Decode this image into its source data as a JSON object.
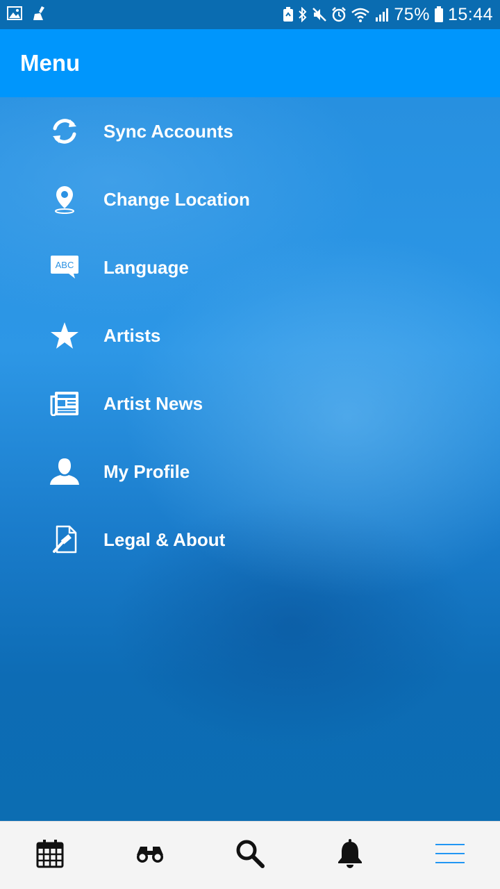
{
  "status_bar": {
    "battery": "75%",
    "time": "15:44"
  },
  "header": {
    "title": "Menu"
  },
  "menu": {
    "items": [
      {
        "label": "Sync Accounts",
        "icon": "sync-icon"
      },
      {
        "label": "Change Location",
        "icon": "location-pin-icon"
      },
      {
        "label": "Language",
        "icon": "language-abc-icon"
      },
      {
        "label": "Artists",
        "icon": "star-icon"
      },
      {
        "label": "Artist News",
        "icon": "newspaper-icon"
      },
      {
        "label": "My Profile",
        "icon": "profile-icon"
      },
      {
        "label": "Legal & About",
        "icon": "legal-document-icon"
      }
    ]
  },
  "bottom_nav": {
    "items": [
      {
        "icon": "calendar-icon"
      },
      {
        "icon": "binoculars-icon"
      },
      {
        "icon": "search-icon"
      },
      {
        "icon": "bell-icon"
      },
      {
        "icon": "hamburger-menu-icon",
        "active": true
      }
    ]
  },
  "colors": {
    "header": "#0096fc",
    "status_bar": "#0a6cb1",
    "nav_active": "#2196f3",
    "nav_icon": "#111111"
  }
}
